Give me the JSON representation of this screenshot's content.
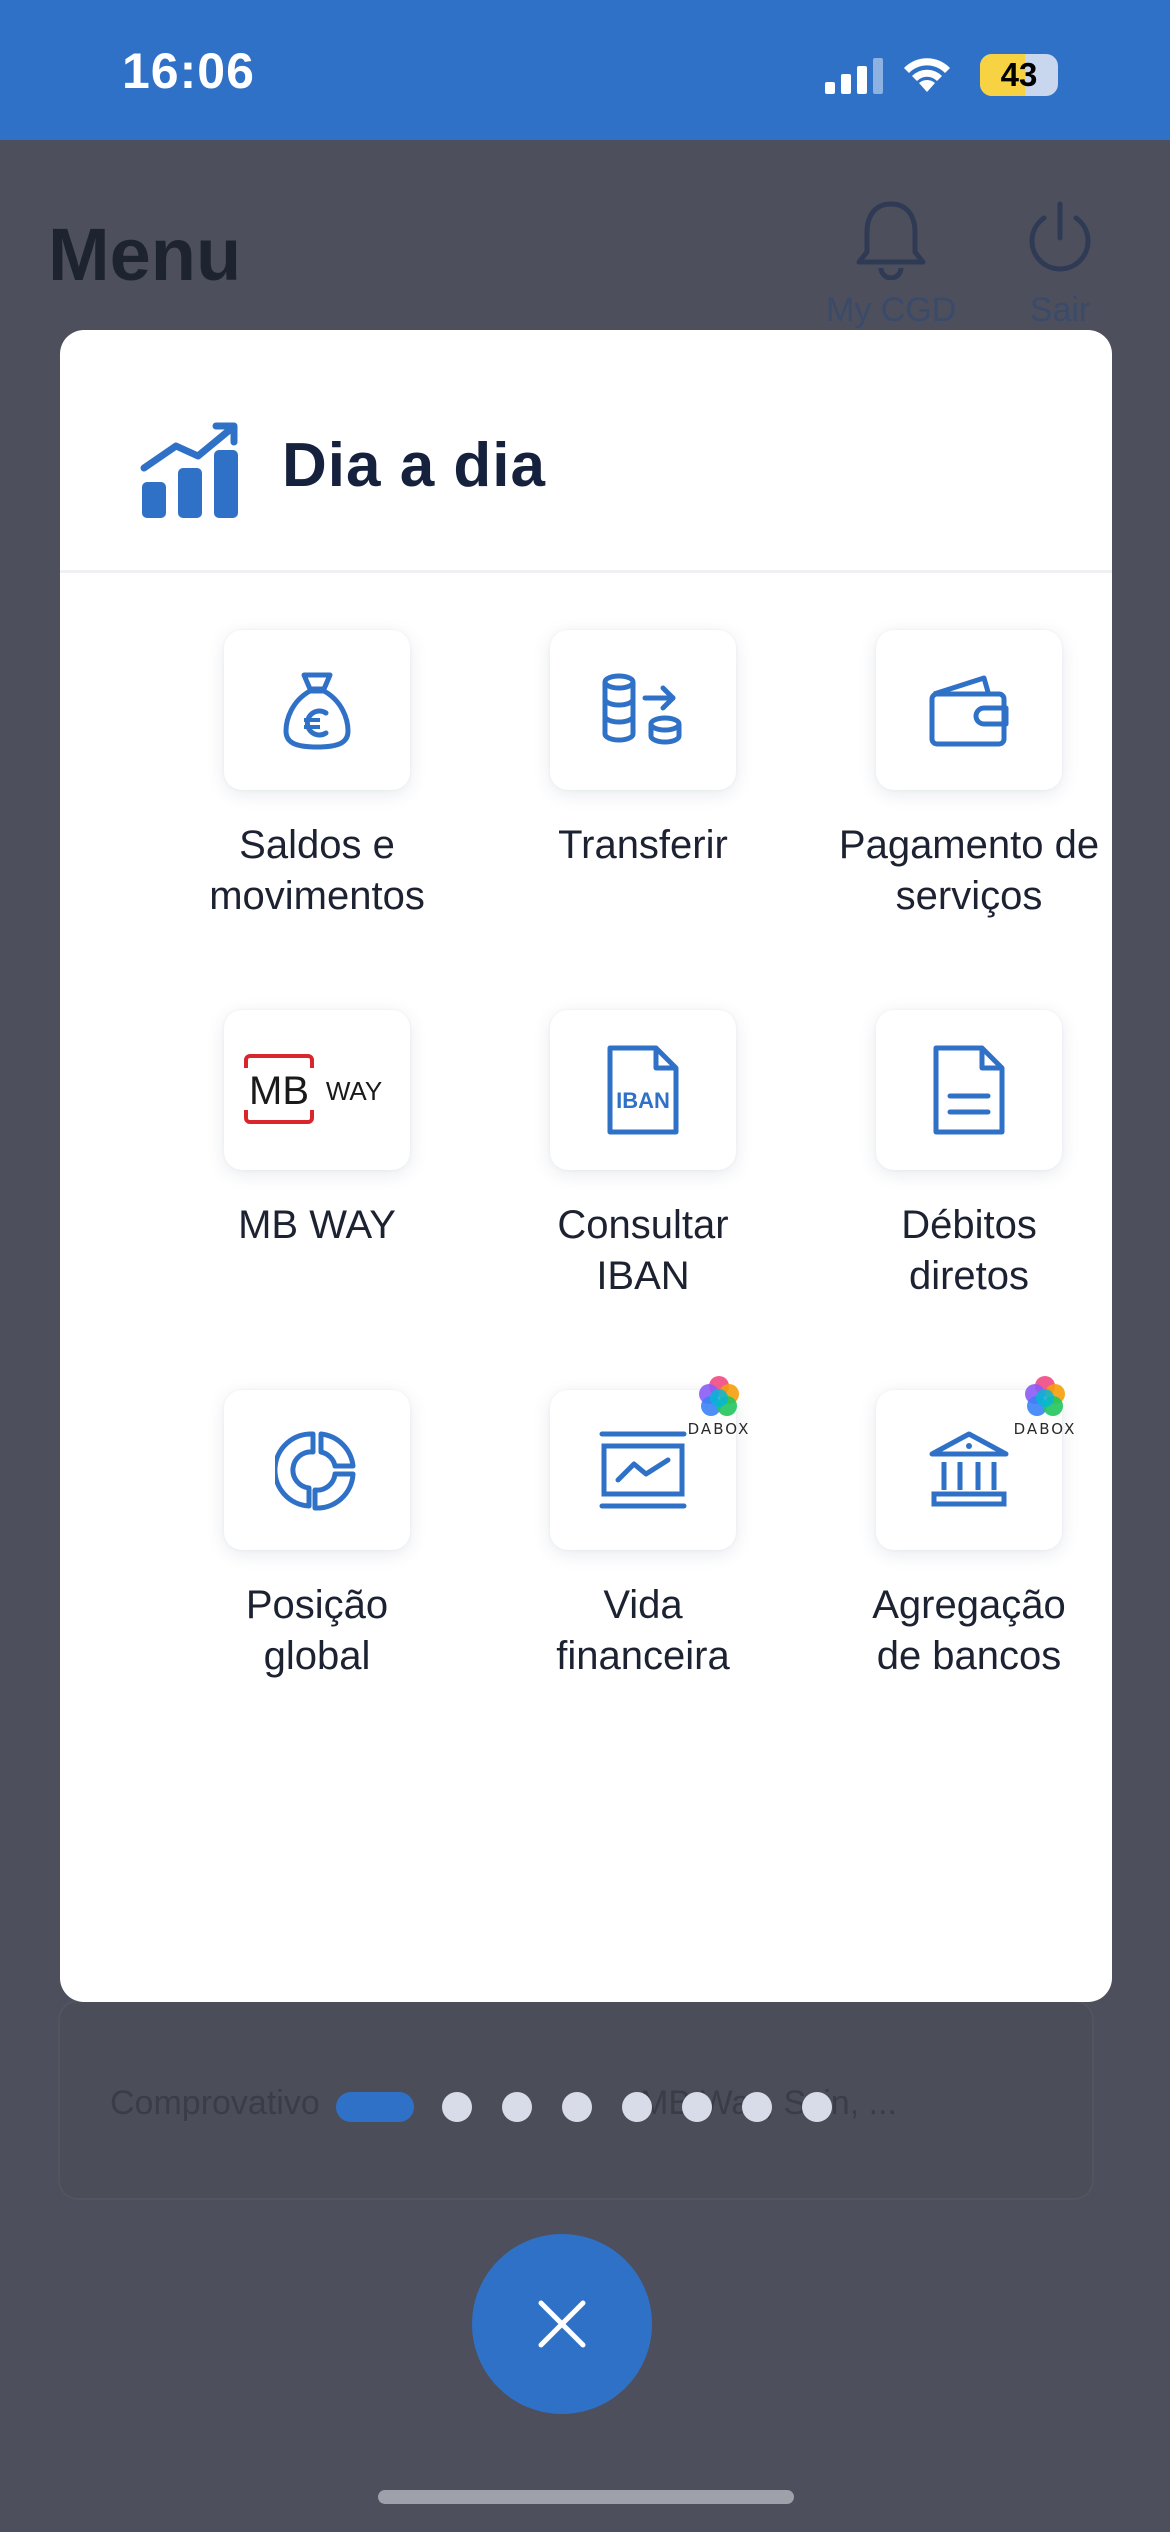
{
  "status_bar": {
    "time": "16:06",
    "battery": "43"
  },
  "background": {
    "title": "Menu",
    "notifications_label": "My CGD",
    "logout_label": "Sair",
    "card_left_text": "Comprovativo",
    "card_right_text": "MB Way, Scin, ..."
  },
  "modal": {
    "title": "Dia a dia",
    "tiles": [
      {
        "label_line1": "Saldos e",
        "label_line2": "movimentos",
        "icon": "money-bag-euro-icon"
      },
      {
        "label_line1": "Transferir",
        "label_line2": "",
        "icon": "coins-transfer-icon"
      },
      {
        "label_line1": "Pagamento de",
        "label_line2": "serviços",
        "icon": "wallet-icon"
      },
      {
        "label_line1": "MB WAY",
        "label_line2": "",
        "icon": "mbway-logo"
      },
      {
        "label_line1": "Consultar",
        "label_line2": "IBAN",
        "icon": "iban-document-icon"
      },
      {
        "label_line1": "Débitos",
        "label_line2": "diretos",
        "icon": "document-icon"
      },
      {
        "label_line1": "Posição",
        "label_line2": "global",
        "icon": "pie-chart-icon"
      },
      {
        "label_line1": "Vida",
        "label_line2": "financeira",
        "icon": "financial-chart-icon",
        "badge": "DABOX"
      },
      {
        "label_line1": "Agregação",
        "label_line2": "de bancos",
        "icon": "bank-icon",
        "badge": "DABOX"
      }
    ],
    "mbway_logo": {
      "mb": "MB",
      "way": "WAY"
    },
    "iban_label": "IBAN"
  },
  "pager": {
    "total": 8,
    "active": 1
  },
  "colors": {
    "primary": "#3071c8",
    "overlay": "#4d505c",
    "title_text": "#15213d",
    "mb_red": "#d9262c"
  }
}
